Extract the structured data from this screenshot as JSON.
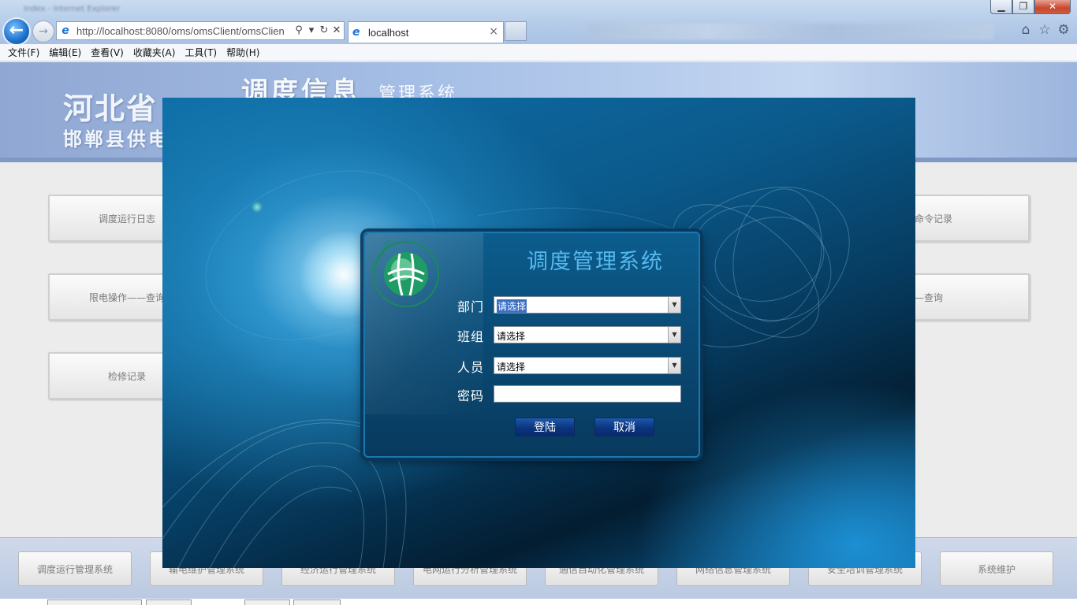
{
  "browser": {
    "title_blur": "Index - Internet Explorer",
    "window_buttons": [
      "▁",
      "❐",
      "✕"
    ],
    "address": "http://localhost:8080/oms/omsClient/omsClien",
    "tab_label": "localhost",
    "menu": [
      "文件(F)",
      "编辑(E)",
      "查看(V)",
      "收藏夹(A)",
      "工具(T)",
      "帮助(H)"
    ]
  },
  "banner": {
    "province": "河北省",
    "company": "邯郸县供电",
    "title": "调度信息",
    "title_sub": "管理系统"
  },
  "tiles": {
    "left": [
      "调度运行日志",
      "限电操作——查询",
      "检修记录"
    ],
    "right": [
      "限电操作命令记录",
      "停送电——查询"
    ]
  },
  "bottom_buttons": [
    "调度运行管理系统",
    "输电维护管理系统",
    "经济运行管理系统",
    "电网运行分析管理系统",
    "通信自动化管理系统",
    "网络信息管理系统",
    "安全培训管理系统",
    "系统维护"
  ],
  "login": {
    "title": "调度管理系统",
    "logo_text": "国家电网公司 STATE GRID CORPORATION OF CHINA",
    "fields": {
      "department": {
        "label": "部门",
        "value": "请选择"
      },
      "group": {
        "label": "班组",
        "value": "请选择"
      },
      "person": {
        "label": "人员",
        "value": "请选择"
      },
      "password": {
        "label": "密码",
        "value": ""
      }
    },
    "login_button": "登陆",
    "cancel_button": "取消"
  },
  "colors": {
    "login_title": "#56b8ee",
    "panel": "#0a4b76",
    "button": "#0b3580",
    "banner": "#a6bfe6"
  }
}
